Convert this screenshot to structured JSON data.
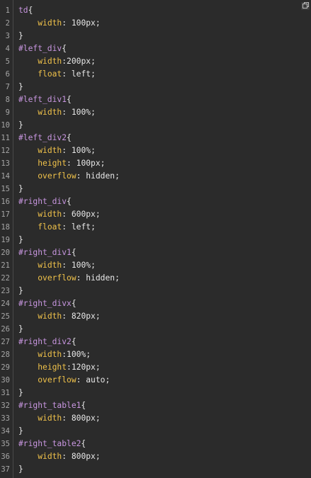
{
  "toolbar": {
    "copy_icon": "copy-icon"
  },
  "colors": {
    "background": "#2b2b2b",
    "line_number": "#a6a6a6",
    "selector": "#c896e0",
    "property": "#f0c24a",
    "text": "#e8e8e8"
  },
  "code_lines": [
    {
      "n": "1",
      "sel": "td",
      "open": "{"
    },
    {
      "n": "2",
      "prop": "width",
      "sep": ": ",
      "val": "100px",
      "end": ";"
    },
    {
      "n": "3",
      "close": "}"
    },
    {
      "n": "4",
      "sel": "#left_div",
      "open": "{"
    },
    {
      "n": "5",
      "prop": "width",
      "sep": ":",
      "val": "200px",
      "end": ";"
    },
    {
      "n": "6",
      "prop": "float",
      "sep": ": ",
      "val": "left",
      "end": ";"
    },
    {
      "n": "7",
      "close": "}"
    },
    {
      "n": "8",
      "sel": "#left_div1",
      "open": "{"
    },
    {
      "n": "9",
      "prop": "width",
      "sep": ": ",
      "val": "100%",
      "end": ";"
    },
    {
      "n": "10",
      "close": "}"
    },
    {
      "n": "11",
      "sel": "#left_div2",
      "open": "{"
    },
    {
      "n": "12",
      "prop": "width",
      "sep": ": ",
      "val": "100%",
      "end": ";"
    },
    {
      "n": "13",
      "prop": "height",
      "sep": ": ",
      "val": "100px",
      "end": ";"
    },
    {
      "n": "14",
      "prop": "overflow",
      "sep": ": ",
      "val": "hidden",
      "end": ";"
    },
    {
      "n": "15",
      "close": "}"
    },
    {
      "n": "16",
      "sel": "#right_div",
      "open": "{"
    },
    {
      "n": "17",
      "prop": "width",
      "sep": ": ",
      "val": "600px",
      "end": ";"
    },
    {
      "n": "18",
      "prop": "float",
      "sep": ": ",
      "val": "left",
      "end": ";"
    },
    {
      "n": "19",
      "close": "}"
    },
    {
      "n": "20",
      "sel": "#right_div1",
      "open": "{"
    },
    {
      "n": "21",
      "prop": "width",
      "sep": ": ",
      "val": "100%",
      "end": ";"
    },
    {
      "n": "22",
      "prop": "overflow",
      "sep": ": ",
      "val": "hidden",
      "end": ";"
    },
    {
      "n": "23",
      "close": "}"
    },
    {
      "n": "24",
      "sel": "#right_divx",
      "open": "{"
    },
    {
      "n": "25",
      "prop": "width",
      "sep": ": ",
      "val": "820px",
      "end": ";"
    },
    {
      "n": "26",
      "close": "}"
    },
    {
      "n": "27",
      "sel": "#right_div2",
      "open": "{"
    },
    {
      "n": "28",
      "prop": "width",
      "sep": ":",
      "val": "100%",
      "end": ";"
    },
    {
      "n": "29",
      "prop": "height",
      "sep": ":",
      "val": "120px",
      "end": ";"
    },
    {
      "n": "30",
      "prop": "overflow",
      "sep": ": ",
      "val": "auto",
      "end": ";"
    },
    {
      "n": "31",
      "close": "}"
    },
    {
      "n": "32",
      "sel": "#right_table1",
      "open": "{"
    },
    {
      "n": "33",
      "prop": "width",
      "sep": ": ",
      "val": "800px",
      "end": ";"
    },
    {
      "n": "34",
      "close": "}"
    },
    {
      "n": "35",
      "sel": "#right_table2",
      "open": "{"
    },
    {
      "n": "36",
      "prop": "width",
      "sep": ": ",
      "val": "800px",
      "end": ";"
    },
    {
      "n": "37",
      "close": "}"
    }
  ]
}
